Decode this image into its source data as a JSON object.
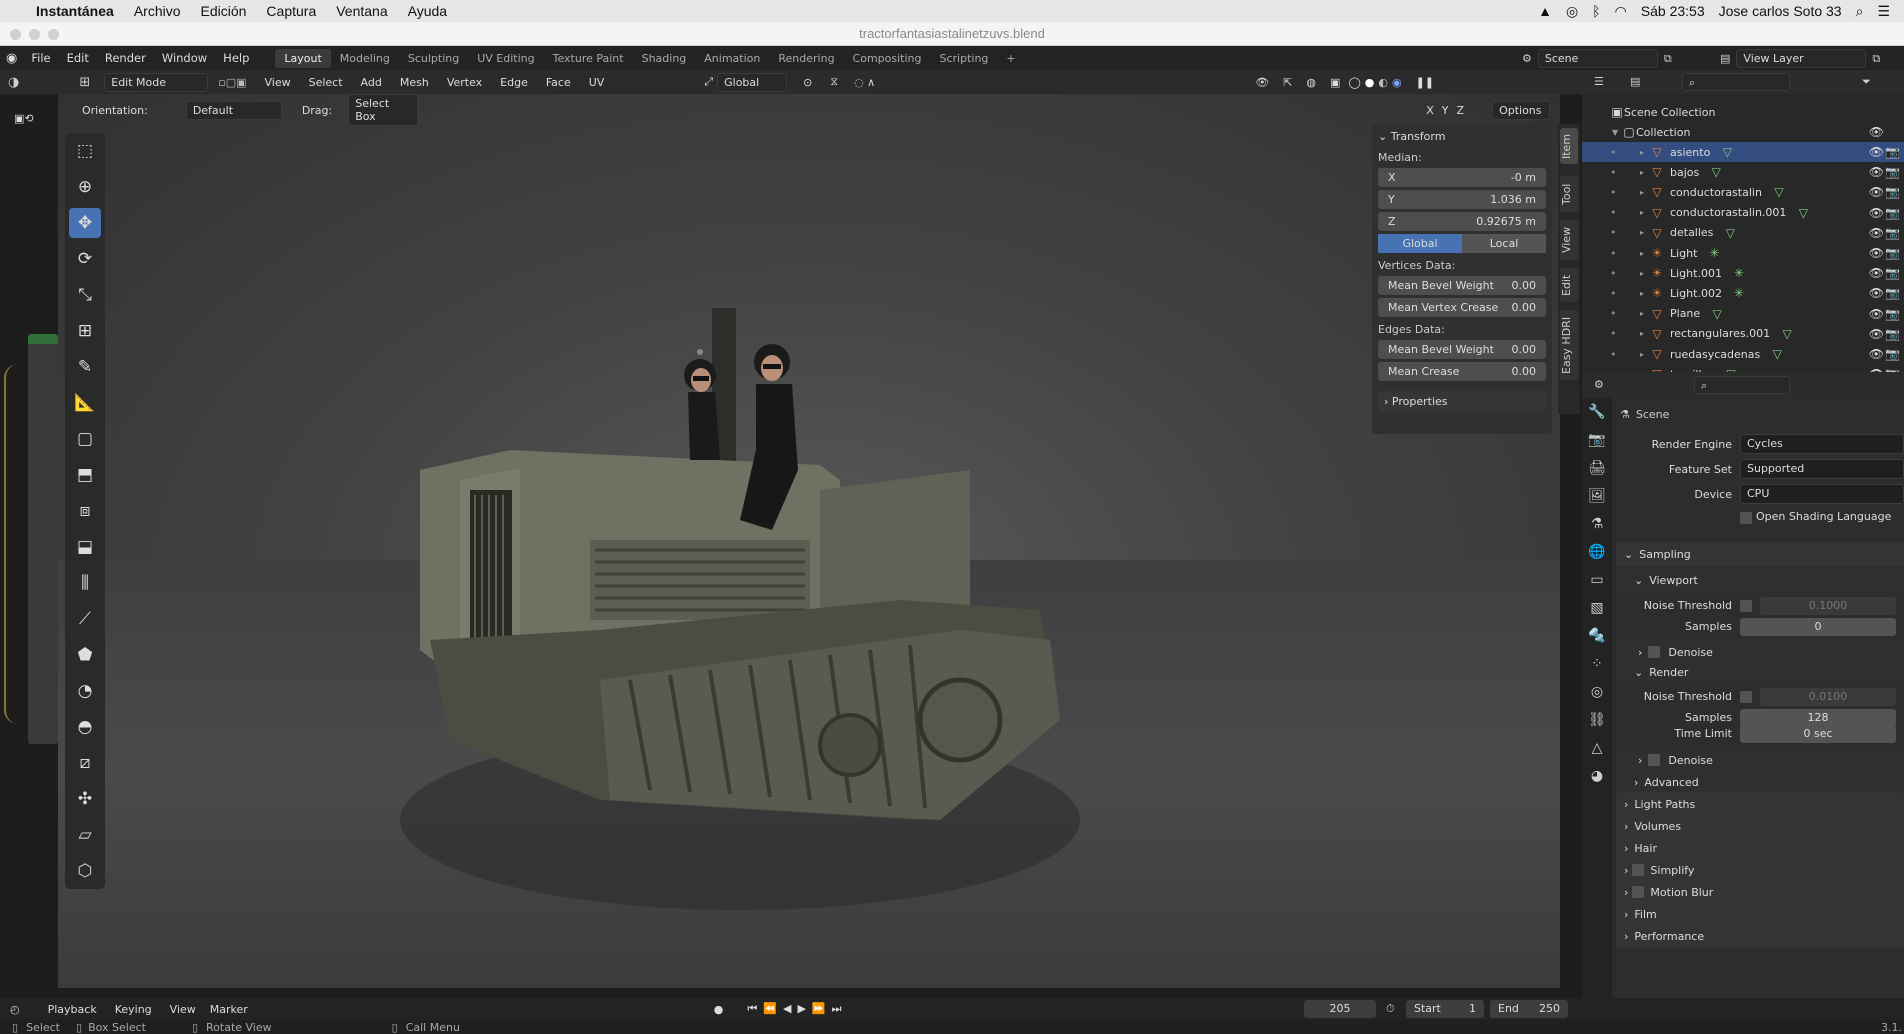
{
  "mac": {
    "app": "Instantánea",
    "menu": [
      "Archivo",
      "Edición",
      "Captura",
      "Ventana",
      "Ayuda"
    ],
    "clock": "Sáb 23:53",
    "user": "Jose carlos Soto 33"
  },
  "window_title": "tractorfantasiastalinetzuvs.blend",
  "blender_menu": [
    "File",
    "Edit",
    "Render",
    "Window",
    "Help"
  ],
  "workspaces": [
    "Layout",
    "Modeling",
    "Sculpting",
    "UV Editing",
    "Texture Paint",
    "Shading",
    "Animation",
    "Rendering",
    "Compositing",
    "Scripting",
    "+"
  ],
  "scene": "Scene",
  "view_layer": "View Layer",
  "viewport_header": {
    "mode": "Edit Mode",
    "menus": [
      "View",
      "Select",
      "Add",
      "Mesh",
      "Vertex",
      "Edge",
      "Face",
      "UV"
    ],
    "transform_orientation": "Global",
    "axes": [
      "X",
      "Y",
      "Z"
    ],
    "options": "Options"
  },
  "tool_settings": {
    "orientation_label": "Orientation:",
    "orientation_value": "Default",
    "drag_label": "Drag:",
    "drag_value": "Select Box"
  },
  "npanel": {
    "transform_title": "Transform",
    "median_label": "Median:",
    "x_label": "X",
    "x_value": "-0 m",
    "y_label": "Y",
    "y_value": "1.036 m",
    "z_label": "Z",
    "z_value": "0.92675 m",
    "global": "Global",
    "local": "Local",
    "vertices_data": "Vertices Data:",
    "mean_bevel_weight": "Mean Bevel Weight",
    "mean_bevel_weight_v": "0.00",
    "mean_vertex_crease": "Mean Vertex Crease",
    "mean_vertex_crease_v": "0.00",
    "edges_data": "Edges Data:",
    "mean_bevel_weight_e": "Mean Bevel Weight",
    "mean_bevel_weight_e_v": "0.00",
    "mean_crease": "Mean Crease",
    "mean_crease_v": "0.00",
    "properties": "Properties",
    "tabs": [
      "Item",
      "Tool",
      "View",
      "Edit",
      "Easy HDRI"
    ]
  },
  "outliner": {
    "scene_collection": "Scene Collection",
    "collection": "Collection",
    "items": [
      {
        "name": "asiento",
        "type": "mesh"
      },
      {
        "name": "bajos",
        "type": "mesh"
      },
      {
        "name": "conductorastalin",
        "type": "mesh"
      },
      {
        "name": "conductorastalin.001",
        "type": "mesh"
      },
      {
        "name": "detalles",
        "type": "mesh"
      },
      {
        "name": "Light",
        "type": "light"
      },
      {
        "name": "Light.001",
        "type": "light"
      },
      {
        "name": "Light.002",
        "type": "light"
      },
      {
        "name": "Plane",
        "type": "mesh"
      },
      {
        "name": "rectangulares.001",
        "type": "mesh"
      },
      {
        "name": "ruedasycadenas",
        "type": "mesh"
      },
      {
        "name": "tornillos",
        "type": "mesh"
      }
    ]
  },
  "properties": {
    "context": "Scene",
    "render_engine_label": "Render Engine",
    "render_engine": "Cycles",
    "feature_set_label": "Feature Set",
    "feature_set": "Supported",
    "device_label": "Device",
    "device": "CPU",
    "osl": "Open Shading Language",
    "sampling": "Sampling",
    "viewport": "Viewport",
    "noise_threshold": "Noise Threshold",
    "vp_noise_threshold": "0.1000",
    "samples": "Samples",
    "vp_samples": "0",
    "denoise": "Denoise",
    "render": "Render",
    "r_noise_threshold": "0.0100",
    "r_samples": "128",
    "time_limit": "Time Limit",
    "time_limit_v": "0 sec",
    "advanced": "Advanced",
    "light_paths": "Light Paths",
    "volumes": "Volumes",
    "hair": "Hair",
    "simplify": "Simplify",
    "motion_blur": "Motion Blur",
    "film": "Film",
    "performance": "Performance"
  },
  "timeline": {
    "menus": [
      "Playback",
      "Keying",
      "View",
      "Marker"
    ],
    "current_frame": "205",
    "start_label": "Start",
    "start": "1",
    "end_label": "End",
    "end": "250"
  },
  "statusbar": {
    "select": "Select",
    "box_select": "Box Select",
    "rotate_view": "Rotate View",
    "call_menu": "Call Menu",
    "version": "3.1."
  }
}
